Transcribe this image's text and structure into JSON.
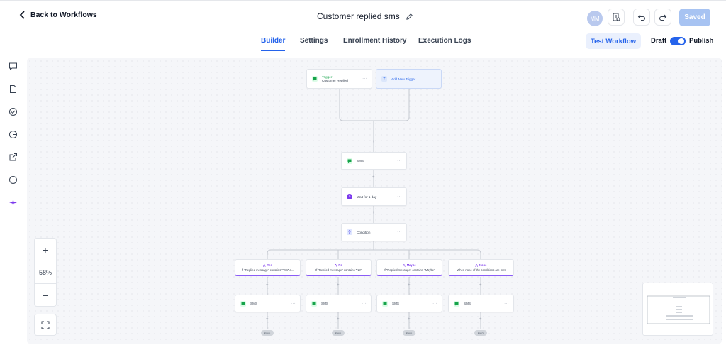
{
  "header": {
    "back_label": "Back to Workflows",
    "workflow_title": "Customer replied sms",
    "avatar_initials": "MM",
    "saved_label": "Saved"
  },
  "tabs": [
    {
      "label": "Builder",
      "active": true
    },
    {
      "label": "Settings",
      "active": false
    },
    {
      "label": "Enrollment History",
      "active": false
    },
    {
      "label": "Execution Logs",
      "active": false
    }
  ],
  "actions": {
    "test_label": "Test Workflow",
    "draft_label": "Draft",
    "publish_label": "Publish",
    "published": true
  },
  "nav_icons": [
    "chat-icon",
    "document-icon",
    "check-circle-icon",
    "pie-chart-icon",
    "external-link-icon",
    "history-icon",
    "ai-sparkle-icon"
  ],
  "canvas": {
    "trigger": {
      "title": "Trigger",
      "subtitle": "Customer Replied"
    },
    "add_trigger": "Add New Trigger",
    "sms": "SMS",
    "wait": "Wait for 1 day",
    "condition": "Condition",
    "branches": [
      {
        "label": "Yes",
        "desc": "If \"Replied message\" contains \"Yes\" a..."
      },
      {
        "label": "No",
        "desc": "If \"Replied message\" contains \"No\""
      },
      {
        "label": "Maybe",
        "desc": "If \"Replied message\" contains \"Maybe\""
      },
      {
        "label": "None",
        "desc": "When none of the conditions are met"
      }
    ],
    "branch_sms": "SMS",
    "end_label": "END",
    "dots": "···"
  },
  "zoom": {
    "plus": "+",
    "level": "58%",
    "minus": "−"
  },
  "colors": {
    "accent": "#2563eb",
    "condition": "#8b5cf6",
    "sms_green": "#16a34a"
  }
}
